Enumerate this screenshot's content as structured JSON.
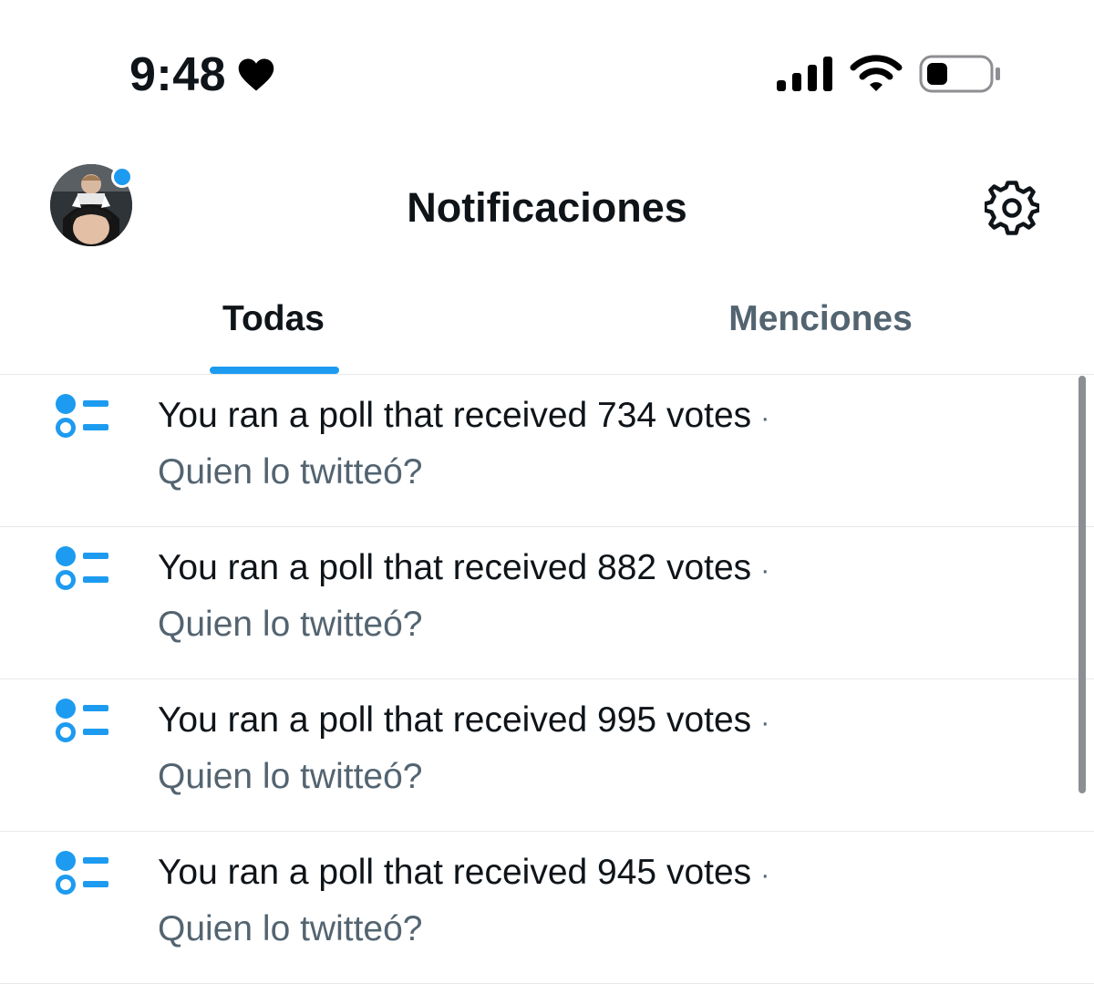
{
  "status_bar": {
    "time": "9:48",
    "icons": [
      "heart-icon",
      "signal-icon",
      "wifi-icon",
      "battery-icon"
    ]
  },
  "header": {
    "title": "Notificaciones",
    "avatar": "avatar",
    "settings_icon": "gear-icon"
  },
  "tabs": [
    {
      "label": "Todas",
      "active": true
    },
    {
      "label": "Menciones",
      "active": false
    }
  ],
  "notifications": [
    {
      "icon": "poll-icon",
      "text": "You ran a poll that received 734 votes",
      "separator": "·",
      "subtitle": "Quien lo twitteó?"
    },
    {
      "icon": "poll-icon",
      "text": "You ran a poll that received 882 votes",
      "separator": "·",
      "subtitle": "Quien lo twitteó?"
    },
    {
      "icon": "poll-icon",
      "text": "You ran a poll that received 995 votes",
      "separator": "·",
      "subtitle": "Quien lo twitteó?"
    },
    {
      "icon": "poll-icon",
      "text": "You ran a poll that received 945 votes",
      "separator": "·",
      "subtitle": "Quien lo twitteó?"
    }
  ],
  "colors": {
    "accent": "#1d9bf0",
    "text_primary": "#0f1419",
    "text_secondary": "#536471",
    "divider": "#e6e8ea"
  }
}
